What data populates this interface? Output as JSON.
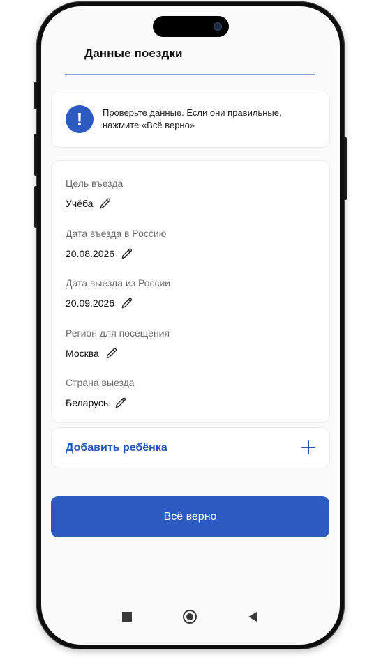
{
  "header": {
    "title": "Данные поездки"
  },
  "notice": {
    "icon": "exclamation-icon",
    "text": "Проверьте данные. Если они правильные, нажмите «Всё верно»"
  },
  "fields": [
    {
      "label": "Цель въезда",
      "value": "Учёба"
    },
    {
      "label": "Дата въезда в Россию",
      "value": "20.08.2026"
    },
    {
      "label": "Дата выезда из России",
      "value": "20.09.2026"
    },
    {
      "label": "Регион для посещения",
      "value": "Москва"
    },
    {
      "label": "Страна выезда",
      "value": "Беларусь"
    }
  ],
  "add_child": {
    "label": "Добавить ребёнка"
  },
  "confirm": {
    "label": "Всё верно"
  },
  "colors": {
    "accent": "#2b5bc1",
    "link": "#2456b5",
    "divider": "#7a9dd1"
  }
}
